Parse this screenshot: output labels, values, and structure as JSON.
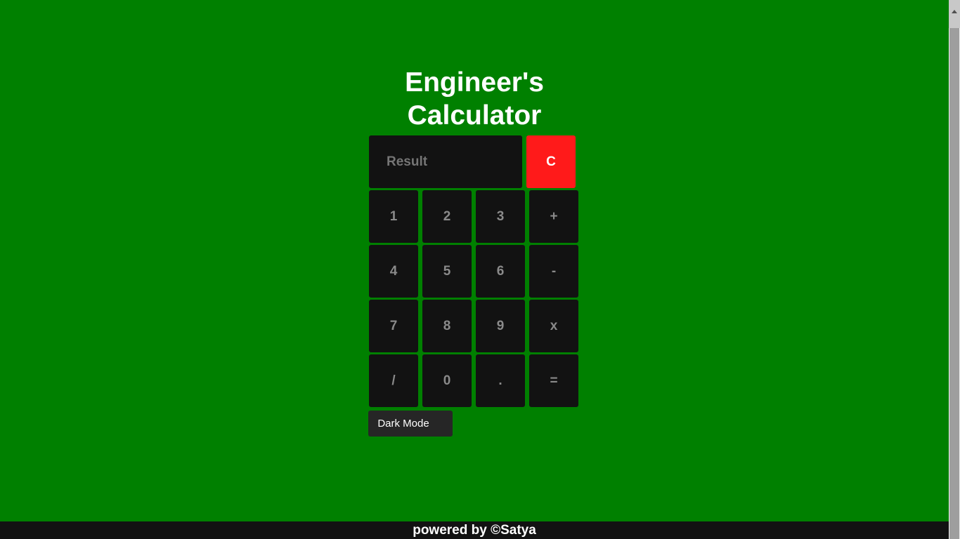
{
  "title": {
    "line1": "Engineer's",
    "line2": "Calculator"
  },
  "display": {
    "placeholder": "Result",
    "value": ""
  },
  "clear": {
    "label": "C"
  },
  "keys": [
    "1",
    "2",
    "3",
    "+",
    "4",
    "5",
    "6",
    "-",
    "7",
    "8",
    "9",
    "x",
    "/",
    "0",
    ".",
    "="
  ],
  "dark_mode": {
    "label": "Dark Mode",
    "icon": "moon-icon"
  },
  "footer": {
    "text": "powered by ©Satya"
  },
  "colors": {
    "background": "#008000",
    "key": "#121212",
    "key_text": "#8a8a8a",
    "clear": "#ff1a1a",
    "footer": "#121212"
  }
}
